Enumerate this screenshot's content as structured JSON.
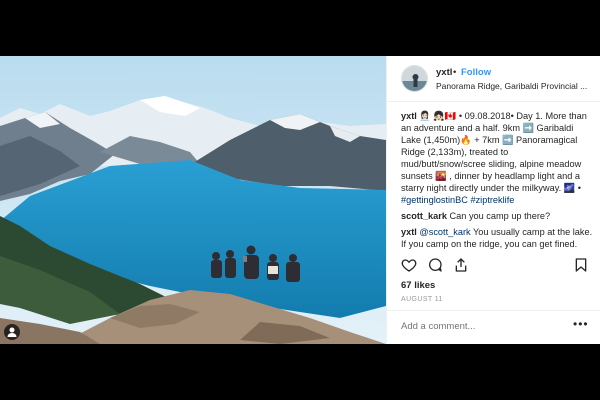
{
  "post": {
    "username": "yxtl",
    "separator": "•",
    "follow_label": "Follow",
    "location": "Panorama Ridge, Garibaldi Provincial ..."
  },
  "caption": {
    "username": "yxtl",
    "text": "👩🏻‍💼 👧🏻🇨🇦 • 09.08.2018• Day 1. More than an adventure and a half. 9km ➡️ Garibaldi Lake (1,450m)🔥 + 7km ➡️ Panoramagical Ridge (2,133m), treated to mud/butt/snow/scree sliding, alpine meadow sunsets 🌇 , dinner by headlamp light and a starry night directly under the milkyway. 🌌 • ",
    "hashtag1": "#gettinglostinBC",
    "hashtag2": "#ziptreklife"
  },
  "comments": [
    {
      "username": "scott_kark",
      "text": "Can you camp up there?"
    },
    {
      "username": "yxtl",
      "mention": "@scott_kark",
      "text": "You usually camp at the lake. If you camp on the ridge, you can get fined."
    }
  ],
  "icons": {
    "like": "heart-icon",
    "comment": "comment-icon",
    "share": "share-icon",
    "save": "bookmark-icon",
    "profile": "person-icon"
  },
  "likes_label": "67 likes",
  "date_label": "AUGUST 11",
  "comment_placeholder": "Add a comment...",
  "more_label": "•••",
  "colors": {
    "link_blue": "#3897f0",
    "hashtag": "#003569",
    "lake": "#1f8fc4",
    "sky": "#cfe6f3"
  }
}
